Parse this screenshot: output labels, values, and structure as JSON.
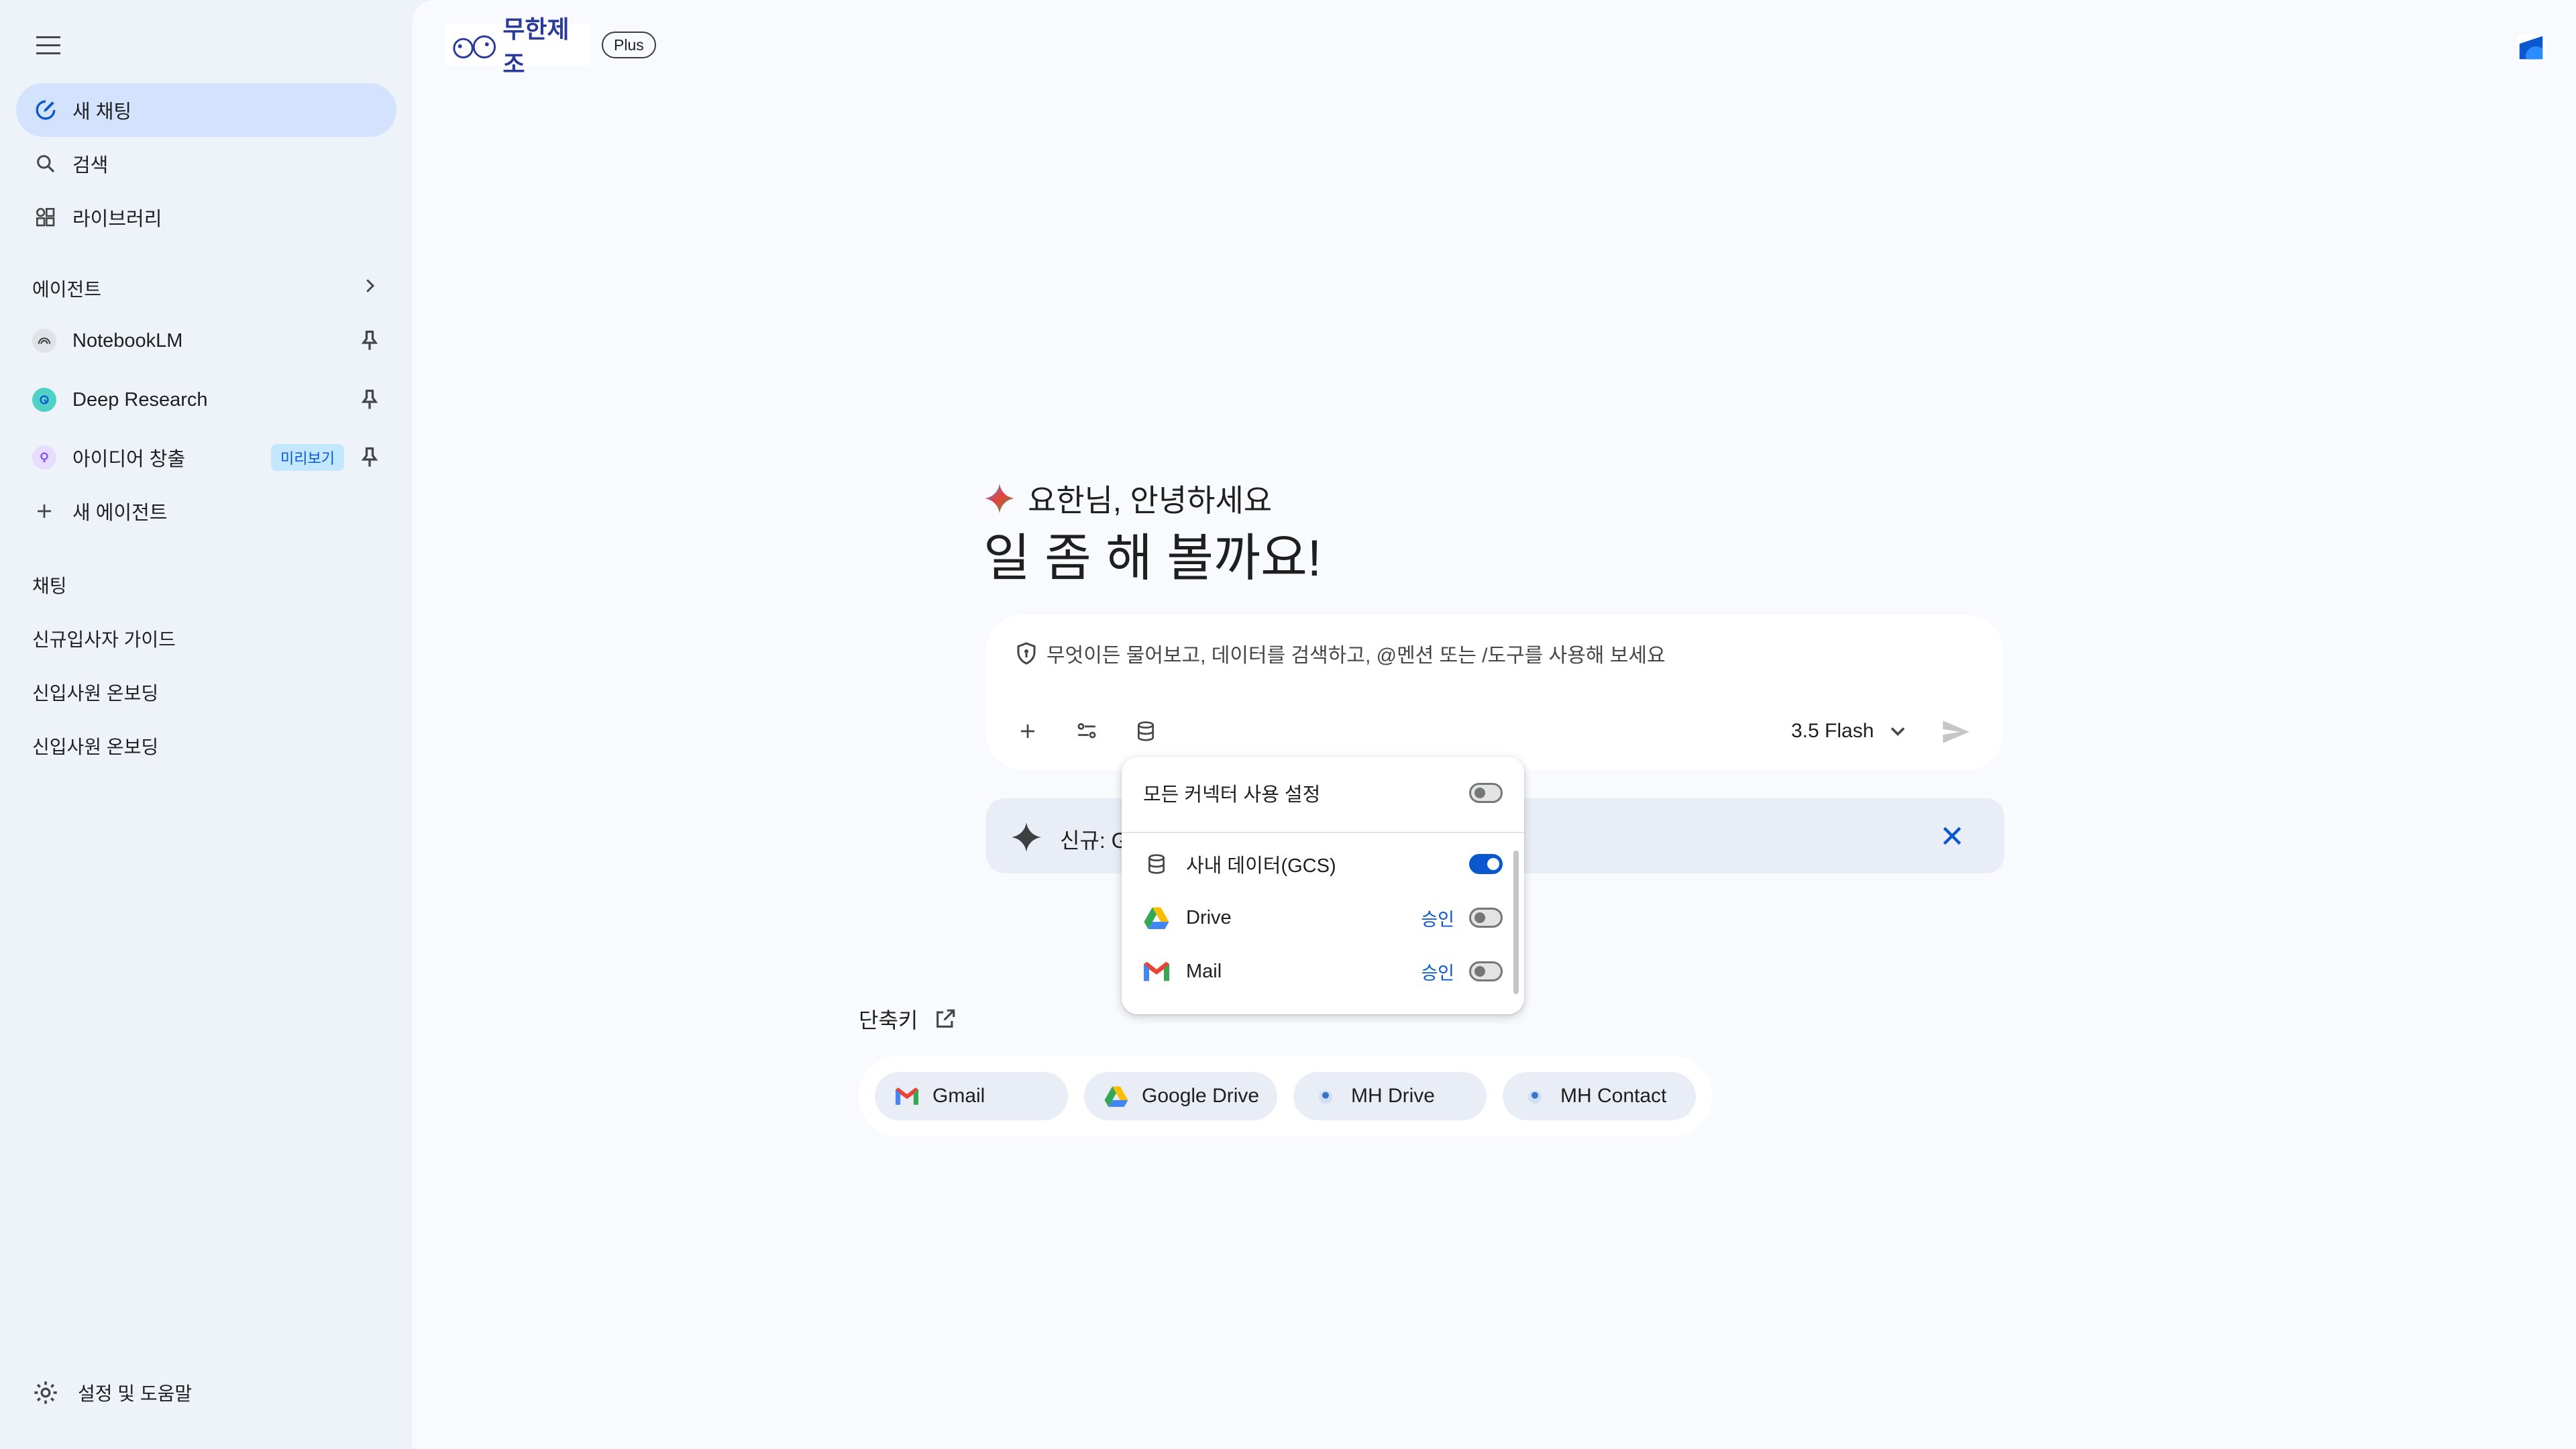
{
  "sidebar": {
    "nav": [
      {
        "label": "새 채팅",
        "icon": "new-chat-icon"
      },
      {
        "label": "검색",
        "icon": "search-icon"
      },
      {
        "label": "라이브러리",
        "icon": "library-icon"
      }
    ],
    "agents_title": "에이전트",
    "agents": [
      {
        "label": "NotebookLM",
        "icon": "notebooklm-icon"
      },
      {
        "label": "Deep Research",
        "icon": "deep-research-icon"
      },
      {
        "label": "아이디어 창출",
        "icon": "idea-icon",
        "badge": "미리보기"
      }
    ],
    "new_agent": "새 에이전트",
    "chats_title": "채팅",
    "chats": [
      "신규입사자 가이드",
      "신입사원 온보딩",
      "신입사원 온보딩"
    ],
    "settings": "설정 및 도움말"
  },
  "header": {
    "brand_text": "무한제조",
    "plan_badge": "Plus"
  },
  "greeting": {
    "line1": "요한님, 안녕하세요",
    "line2": "일 좀 해 볼까요!"
  },
  "input": {
    "placeholder": "무엇이든 물어보고, 데이터를 검색하고, @멘션 또는 /도구를 사용해 보세요",
    "model": "3.5 Flash"
  },
  "banner": {
    "text": "신규: G"
  },
  "connectors": {
    "all_label": "모든 커넥터 사용 설정",
    "all_enabled": false,
    "items": [
      {
        "label": "사내 데이터(GCS)",
        "enabled": true,
        "approve": ""
      },
      {
        "label": "Drive",
        "enabled": false,
        "approve": "승인"
      },
      {
        "label": "Mail",
        "enabled": false,
        "approve": "승인"
      }
    ]
  },
  "shortcuts": {
    "title": "단축키",
    "items": [
      {
        "label": "Gmail",
        "icon": "gmail-icon"
      },
      {
        "label": "Google Drive",
        "icon": "google-drive-icon"
      },
      {
        "label": "MH Drive",
        "icon": "mh-drive-icon"
      },
      {
        "label": "MH Contact",
        "icon": "mh-contact-icon"
      }
    ]
  },
  "colors": {
    "accent": "#0b57d0",
    "active_nav": "#d3e3fd",
    "sidebar_bg": "#eef2f9",
    "main_bg": "#f8fafd"
  }
}
